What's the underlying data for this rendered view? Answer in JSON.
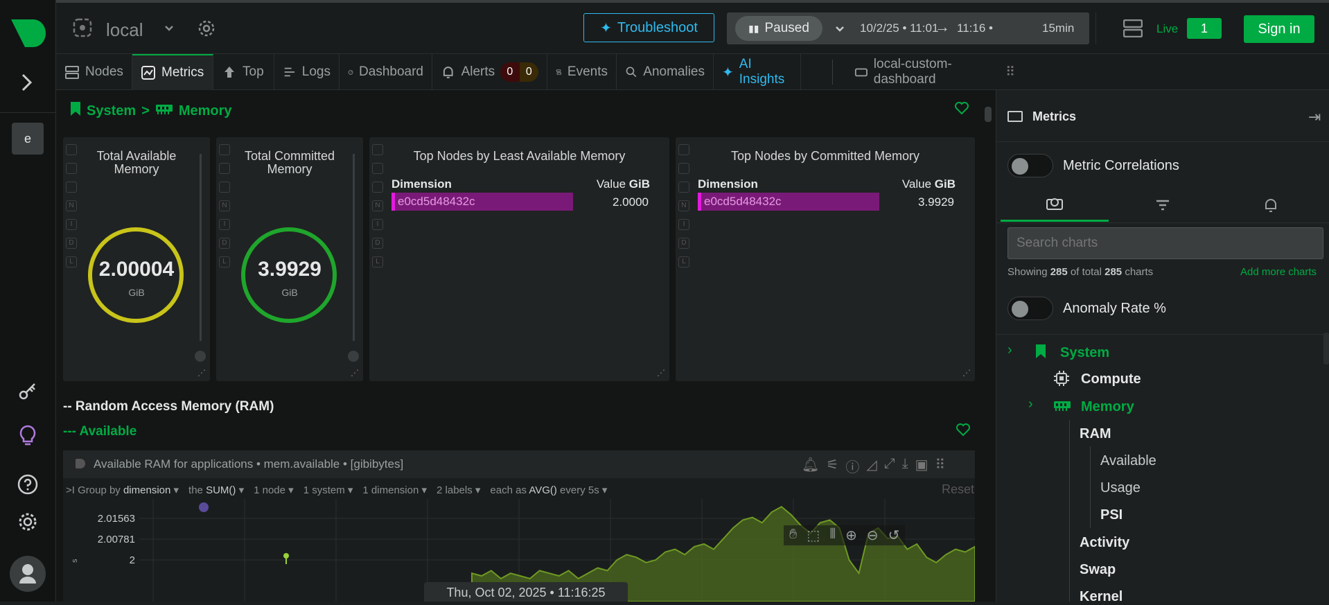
{
  "app": {
    "space_initial": "e",
    "space_name": "local"
  },
  "header": {
    "troubleshoot_label": "Troubleshoot",
    "paused_label": "Paused",
    "time_range": "10/2/25 • 11:01",
    "time_range_end": "11:16 •",
    "duration": "15min",
    "live_label": "Live",
    "live_count": "1",
    "signin_label": "Sign in"
  },
  "tabs": [
    {
      "label": "Nodes",
      "icon": "nodes-icon"
    },
    {
      "label": "Metrics",
      "icon": "metrics-icon"
    },
    {
      "label": "Top",
      "icon": "top-icon"
    },
    {
      "label": "Logs",
      "icon": "logs-icon"
    },
    {
      "label": "Dashboard",
      "icon": "dashboard-icon"
    },
    {
      "label": "Alerts",
      "icon": "bell-icon",
      "critical": "0",
      "warning": "0"
    },
    {
      "label": "Events",
      "icon": "events-icon"
    },
    {
      "label": "Anomalies",
      "icon": "anomalies-icon"
    },
    {
      "label": "AI Insights",
      "icon": "sparkle-icon"
    },
    {
      "label": "local-custom-dashboard",
      "icon": "dashboard-tab-icon"
    }
  ],
  "breadcrumb": {
    "section": "System",
    "sep": ">",
    "sub": "Memory"
  },
  "cards": {
    "total_available": {
      "title": "Total Available Memory",
      "value": "2.00004",
      "unit": "GiB",
      "fraction": 1.0
    },
    "total_committed": {
      "title": "Total Committed Memory",
      "value": "3.9929",
      "unit": "GiB",
      "fraction": 1.0
    },
    "top_least_available": {
      "title": "Top Nodes by Least Available Memory",
      "dim_header": "Dimension",
      "val_header": "Value",
      "unit": "GiB",
      "rows": [
        {
          "dim": "e0cd5d48432c",
          "value": "2.0000"
        }
      ]
    },
    "top_committed": {
      "title": "Top Nodes by Committed Memory",
      "dim_header": "Dimension",
      "val_header": "Value",
      "unit": "GiB",
      "rows": [
        {
          "dim": "e0cd5d48432c",
          "value": "3.9929"
        }
      ]
    }
  },
  "sections": {
    "ram": "-- Random Access Memory (RAM)",
    "available": "--- Available"
  },
  "chart_panel": {
    "title": "Available RAM for applications • mem.available • [gibibytes]",
    "group_by_prefix": ">I Group by",
    "group_by": "dimension",
    "the_label": "the",
    "agg": "SUM()",
    "nodes": "1 node",
    "systems": "1 system",
    "dimensions": "1 dimension",
    "labels": "2 labels",
    "each_as": "each as",
    "each_agg": "AVG()",
    "every": "every 5s",
    "reset": "Reset",
    "timestamp": "Thu, Oct 02, 2025 • 11:16:25"
  },
  "chart_data": {
    "type": "area",
    "yticks": [
      "2.01563",
      "2.00781",
      "2"
    ],
    "ylabel_partial": "s",
    "values": [
      1.995,
      1.994,
      1.996,
      1.993,
      1.995,
      1.994,
      1.993,
      1.996,
      1.995,
      1.994,
      1.996,
      1.993,
      1.995,
      1.997,
      1.996,
      2.0,
      2.002,
      2.001,
      1.999,
      2.0,
      2.003,
      2.004,
      2.002,
      2.005,
      2.006,
      2.004,
      2.008,
      2.012,
      2.015,
      2.016,
      2.014,
      2.018,
      2.02,
      2.017,
      2.013,
      2.01,
      2.014,
      2.015,
      2.012,
      2.0,
      1.995,
      2.01,
      2.012,
      2.008,
      2.009,
      2.004,
      2.006,
      2.001,
      1.999,
      2.002,
      2.004,
      2.003,
      2.005
    ]
  },
  "sidebar": {
    "title": "Metrics",
    "metric_correlations": "Metric Correlations",
    "search_placeholder": "Search charts",
    "showing_prefix": "Showing",
    "showing_count": "285",
    "showing_mid": "of total",
    "showing_total": "285",
    "showing_suffix": "charts",
    "add_more": "Add more charts",
    "anomaly_rate": "Anomaly Rate %",
    "tree": {
      "system": "System",
      "compute": "Compute",
      "memory": "Memory",
      "ram": "RAM",
      "available": "Available",
      "usage": "Usage",
      "psi": "PSI",
      "activity": "Activity",
      "swap": "Swap",
      "kernel": "Kernel"
    }
  },
  "colors": {
    "brand": "#00ab44",
    "accent_blue": "#2fbbf0",
    "gauge_yellow": "#c8c41a",
    "gauge_green": "#1fa62c",
    "dimension_bar": "#7a1a78",
    "area_fill": "#4e6b1f"
  }
}
